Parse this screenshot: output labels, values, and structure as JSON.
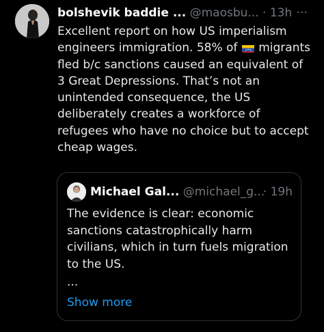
{
  "post": {
    "author": {
      "display_name": "bolshevik baddie ...",
      "handle": "@maosbu...",
      "separator": "·",
      "time": "13h",
      "avatar": "profile-photo"
    },
    "more_icon": "···",
    "text_before_flag": "Excellent report on how US imperialism engineers immigration. 58% of ",
    "flag_icon": "venezuela-flag-icon",
    "text_after_flag": " migrants fled b/c sanctions caused an equivalent of 3 Great Depressions. That’s not an unintended consequence, the US deliberately creates a workforce of refugees who have no choice but to accept cheap wages."
  },
  "quote": {
    "author": {
      "display_name": "Michael Gal...",
      "handle": "@michael_g...",
      "separator": "·",
      "time": "19h",
      "avatar": "profile-photo"
    },
    "text": "The evidence is clear: economic sanctions catastrophically harm civilians, which in turn fuels migration to the US.",
    "ellipsis": "...",
    "show_more": "Show more"
  },
  "colors": {
    "background": "#000000",
    "text": "#e7e9ea",
    "muted": "#71767b",
    "link": "#1d9bf0",
    "border": "#2f3336"
  }
}
